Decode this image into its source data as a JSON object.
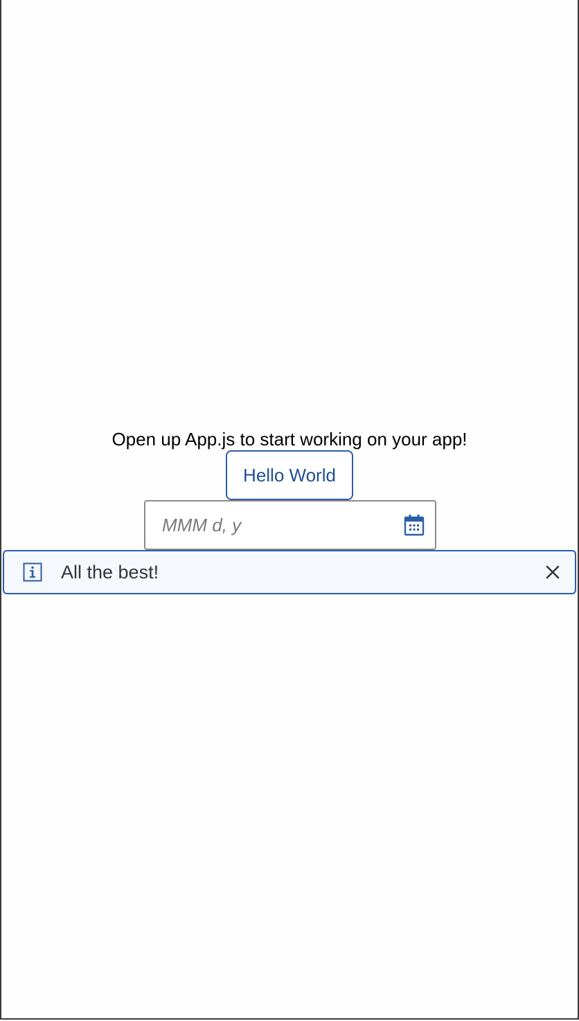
{
  "app": {
    "welcome_text": "Open up App.js to start working on your app!"
  },
  "hello_button": {
    "label": "Hello World"
  },
  "date_picker": {
    "value": "",
    "placeholder": "MMM d, y",
    "icon": "calendar-icon"
  },
  "message_strip": {
    "type": "information",
    "text": "All the best!",
    "icon": "information-icon",
    "close_icon": "close-icon"
  },
  "colors": {
    "accent": "#2b5ea8",
    "text": "#32363a",
    "strip_background": "#f5f8fc",
    "field_border": "#8a8a8a"
  }
}
